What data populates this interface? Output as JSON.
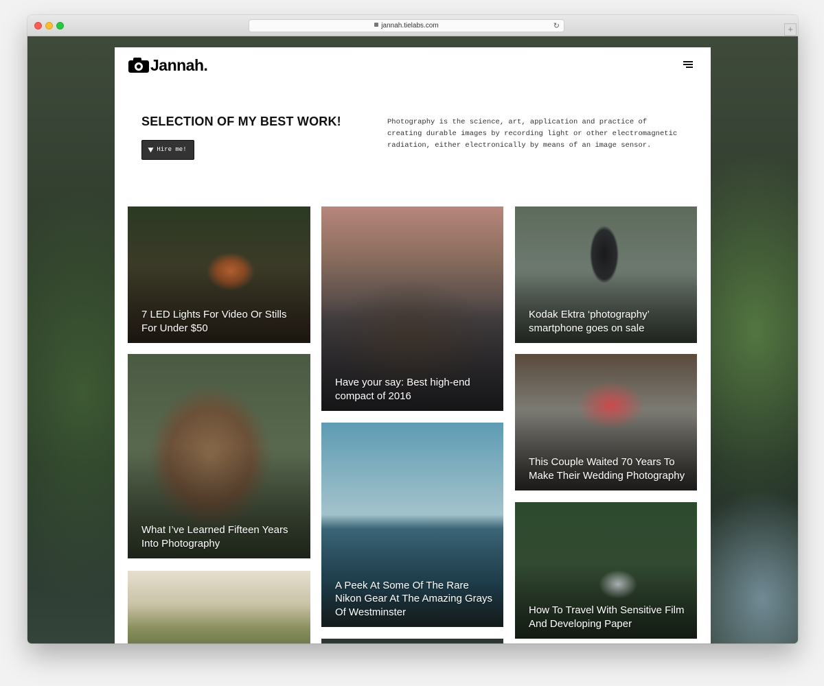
{
  "browser": {
    "url": "jannah.tielabs.com",
    "reload_icon": "reload-icon",
    "new_tab_label": "+"
  },
  "site": {
    "logo_text": "Jannah."
  },
  "hero": {
    "title": "SELECTION OF MY BEST WORK!",
    "button_label": "Hire me!",
    "description": "Photography is the science, art, application and practice of creating durable images by recording light or other electromagnetic radiation, either electronically by means of an image sensor."
  },
  "posts": [
    {
      "title": "7 LED Lights For Video Or Stills For Under $50"
    },
    {
      "title": "Have your say: Best high-end compact of 2016"
    },
    {
      "title": "Kodak Ektra ‘photography’ smartphone goes on sale"
    },
    {
      "title": "What I’ve Learned Fifteen Years Into Photography"
    },
    {
      "title": "A Peek At Some Of The Rare Nikon Gear At The Amazing Grays Of Westminster"
    },
    {
      "title": "This Couple Waited 70 Years To Make Their Wedding Photography"
    },
    {
      "title": "How To Travel With Sensitive Film And Developing Paper"
    }
  ]
}
